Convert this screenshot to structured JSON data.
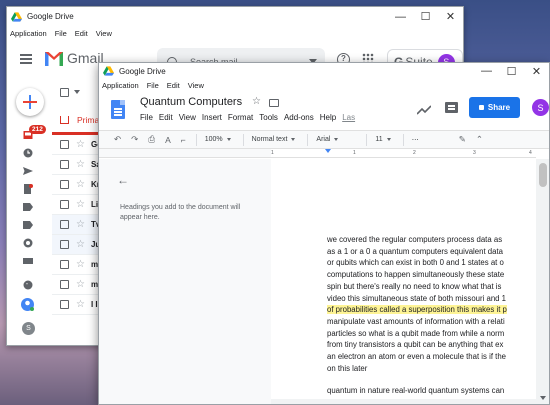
{
  "back_window": {
    "title": "Google Drive",
    "menu": [
      "Application",
      "File",
      "Edit",
      "View"
    ],
    "gmail_label": "Gmail",
    "search_placeholder": "Search mail",
    "help_label": "?",
    "suite_prefix": "G",
    "suite_label": "Suite",
    "avatar_letter": "S",
    "inbox_badge": "212",
    "primary_tab_label": "Prima",
    "rows": [
      "Go",
      "Sa",
      "Kr",
      "Li",
      "Tv",
      "Ju",
      "m",
      "m",
      "I I"
    ]
  },
  "front_window": {
    "title": "Google Drive",
    "menu": [
      "Application",
      "File",
      "Edit",
      "View"
    ],
    "doc_title": "Quantum Computers",
    "doc_menu": [
      "File",
      "Edit",
      "View",
      "Insert",
      "Format",
      "Tools",
      "Add-ons",
      "Help"
    ],
    "last_edit": "Las",
    "share_label": "Share",
    "avatar_letter": "S",
    "toolbar": {
      "zoom": "100%",
      "style": "Normal text",
      "font": "Arial",
      "size": "11",
      "more": "⋯"
    },
    "ruler_numbers": [
      "1",
      "1",
      "2",
      "3",
      "4"
    ],
    "outline_hint": "Headings you add to the document will appear here.",
    "paragraph1_lines": [
      "we covered the regular computers process data as",
      "as a 1 or a 0 a quantum computers equivalent data",
      "or qubits which can exist in both 0 and 1 states at o",
      "computations to happen simultaneously these state",
      "spin but there's really no need to know what that is",
      "video this simultaneous state of both missouri and 1",
      "of probabilities called a superposition this makes it p",
      "manipulate vast amounts of information with a relati",
      "particles so what is a qubit made from while a norm",
      "from tiny transistors a qubit can be anything that ex",
      "an electron an atom or even a molecule that is if the",
      "on this later"
    ],
    "highlight_line_index": 6,
    "paragraph2_lines": [
      "quantum in nature real-world quantum systems can"
    ]
  },
  "colors": {
    "gmail_red": "#d93025",
    "share_blue": "#1a73e8",
    "avatar_purple": "#9334e6",
    "highlight_yellow": "#fef495"
  }
}
